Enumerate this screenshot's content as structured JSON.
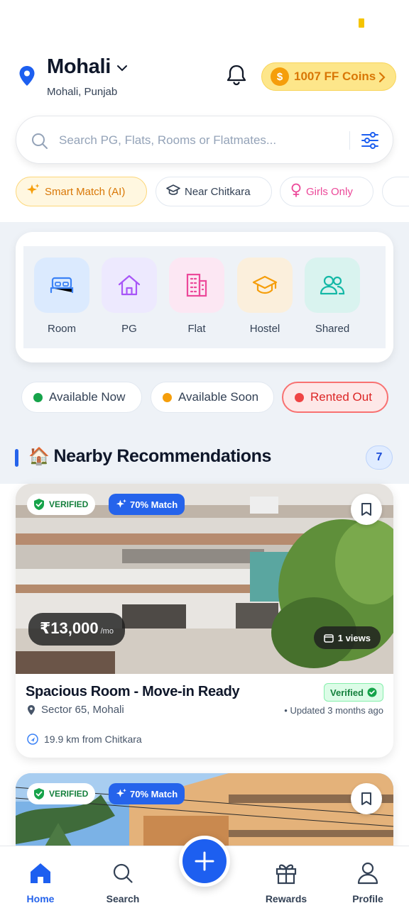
{
  "header": {
    "city": "Mohali",
    "subtitle": "Mohali, Punjab",
    "coins_symbol": "$",
    "coins_label": "1007 FF Coins"
  },
  "search": {
    "placeholder": "Search PG, Flats, Rooms or Flatmates..."
  },
  "chips": [
    {
      "label": "Smart Match (AI)",
      "icon": "sparkle-icon"
    },
    {
      "label": "Near Chitkara",
      "icon": "graduation-cap-icon"
    },
    {
      "label": "Girls Only",
      "icon": "female-icon"
    }
  ],
  "categories": [
    {
      "label": "Room",
      "icon": "bed-icon",
      "color": "#3b82f6",
      "bg": "#dbeafe"
    },
    {
      "label": "PG",
      "icon": "house-icon",
      "color": "#a855f7",
      "bg": "#ede9fe"
    },
    {
      "label": "Flat",
      "icon": "building-icon",
      "color": "#ec4899",
      "bg": "#fce7f3"
    },
    {
      "label": "Hostel",
      "icon": "graduation-cap-icon",
      "color": "#f59e0b",
      "bg": "#fbefdc"
    },
    {
      "label": "Shared",
      "icon": "users-icon",
      "color": "#14b8a6",
      "bg": "#d9f3ef"
    }
  ],
  "availability": [
    {
      "label": "Available Now",
      "color": "#16a34a"
    },
    {
      "label": "Available Soon",
      "color": "#f59e0b"
    },
    {
      "label": "Rented Out",
      "color": "#ef4444"
    }
  ],
  "section": {
    "emoji": "🏠",
    "title": "Nearby Recommendations",
    "count": "7"
  },
  "listings": [
    {
      "verified_badge": "VERIFIED",
      "match": "70% Match",
      "price": "₹13,000",
      "per": "/mo",
      "views": "1 views",
      "title": "Spacious Room - Move-in Ready",
      "verified_tag": "Verified",
      "location": "Sector 65, Mohali",
      "updated": "• Updated 3 months ago",
      "distance": "19.9 km from Chitkara"
    },
    {
      "verified_badge": "VERIFIED",
      "match": "70% Match"
    }
  ],
  "nav": {
    "home": "Home",
    "search": "Search",
    "rewards": "Rewards",
    "profile": "Profile"
  }
}
